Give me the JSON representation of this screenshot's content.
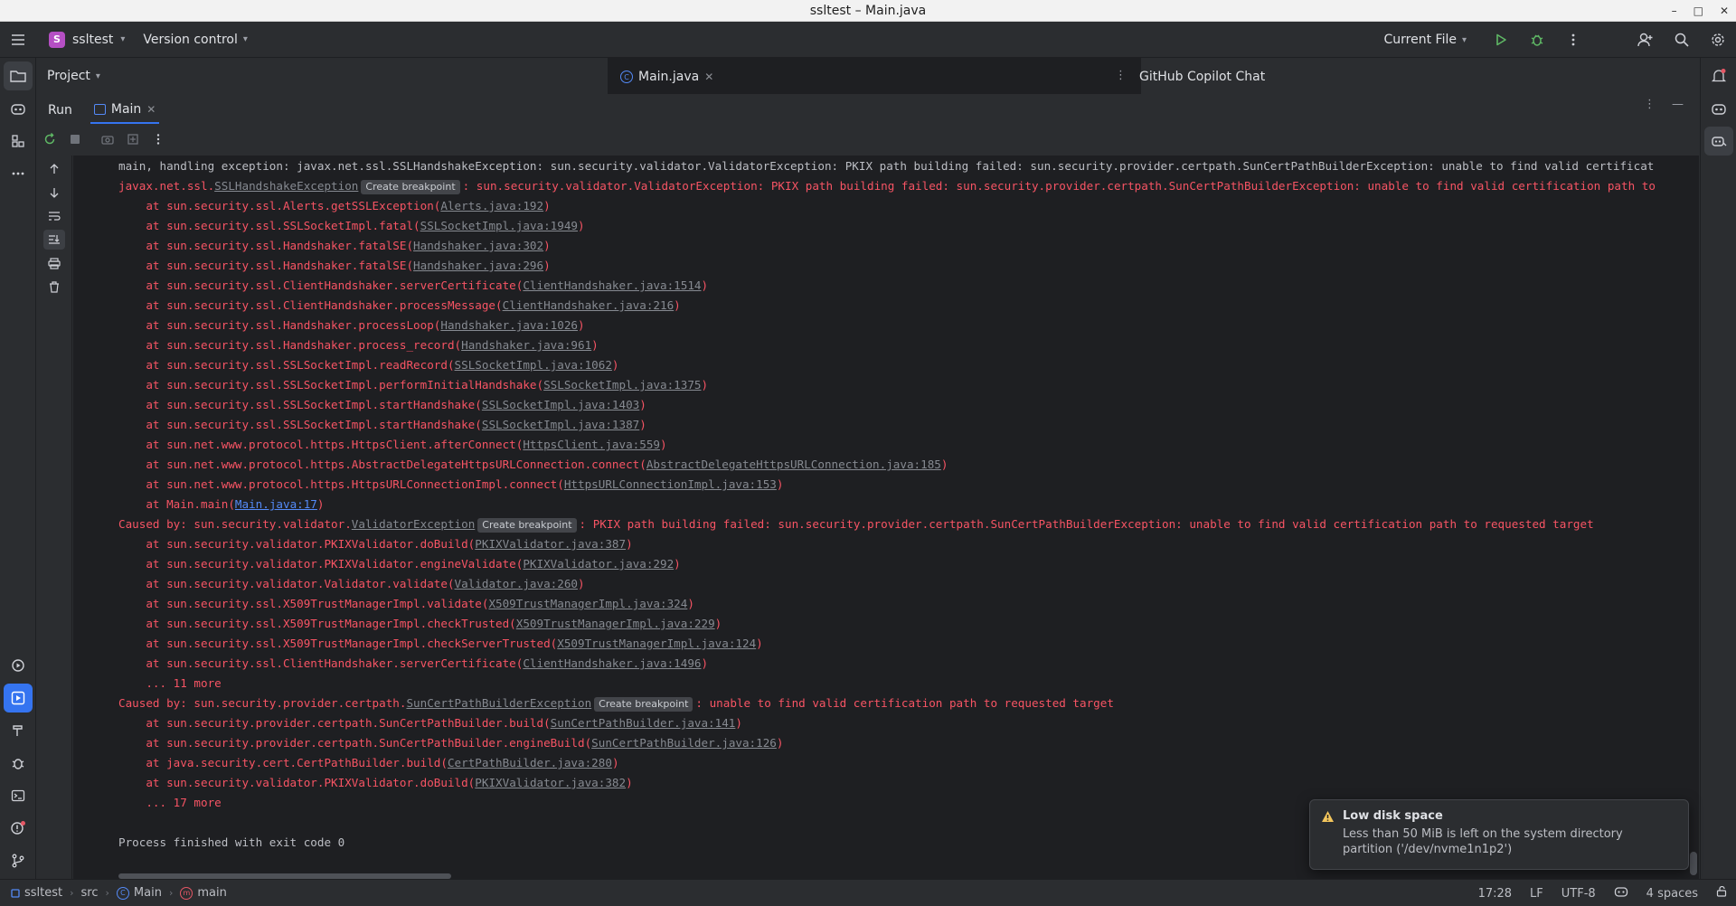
{
  "window": {
    "title": "ssltest – Main.java"
  },
  "toolbar": {
    "project_initial": "S",
    "project_name": "ssltest",
    "vcs_label": "Version control",
    "run_config": "Current File"
  },
  "header": {
    "project_label": "Project",
    "editor_tab": "Main.java",
    "copilot_label": "GitHub Copilot Chat"
  },
  "run_window": {
    "title": "Run",
    "tab_label": "Main"
  },
  "console": {
    "breakpoint_label": "Create breakpoint",
    "lines": {
      "l0": "main, handling exception: javax.net.ssl.SSLHandshakeException: sun.security.validator.ValidatorException: PKIX path building failed: sun.security.provider.certpath.SunCertPathBuilderException: unable to find valid certificat",
      "l1_pre": "javax.net.ssl.",
      "l1_link": "SSLHandshakeException",
      "l1_post": ": sun.security.validator.ValidatorException: PKIX path building failed: sun.security.provider.certpath.SunCertPathBuilderException: unable to find valid certification path to",
      "l2_pre": "    at sun.security.ssl.Alerts.getSSLException(",
      "l2_link": "Alerts.java:192",
      "l3_pre": "    at sun.security.ssl.SSLSocketImpl.fatal(",
      "l3_link": "SSLSocketImpl.java:1949",
      "l4_pre": "    at sun.security.ssl.Handshaker.fatalSE(",
      "l4_link": "Handshaker.java:302",
      "l5_pre": "    at sun.security.ssl.Handshaker.fatalSE(",
      "l5_link": "Handshaker.java:296",
      "l6_pre": "    at sun.security.ssl.ClientHandshaker.serverCertificate(",
      "l6_link": "ClientHandshaker.java:1514",
      "l7_pre": "    at sun.security.ssl.ClientHandshaker.processMessage(",
      "l7_link": "ClientHandshaker.java:216",
      "l8_pre": "    at sun.security.ssl.Handshaker.processLoop(",
      "l8_link": "Handshaker.java:1026",
      "l9_pre": "    at sun.security.ssl.Handshaker.process_record(",
      "l9_link": "Handshaker.java:961",
      "l10_pre": "    at sun.security.ssl.SSLSocketImpl.readRecord(",
      "l10_link": "SSLSocketImpl.java:1062",
      "l11_pre": "    at sun.security.ssl.SSLSocketImpl.performInitialHandshake(",
      "l11_link": "SSLSocketImpl.java:1375",
      "l12_pre": "    at sun.security.ssl.SSLSocketImpl.startHandshake(",
      "l12_link": "SSLSocketImpl.java:1403",
      "l13_pre": "    at sun.security.ssl.SSLSocketImpl.startHandshake(",
      "l13_link": "SSLSocketImpl.java:1387",
      "l14_pre": "    at sun.net.www.protocol.https.HttpsClient.afterConnect(",
      "l14_link": "HttpsClient.java:559",
      "l15_pre": "    at sun.net.www.protocol.https.AbstractDelegateHttpsURLConnection.connect(",
      "l15_link": "AbstractDelegateHttpsURLConnection.java:185",
      "l16_pre": "    at sun.net.www.protocol.https.HttpsURLConnectionImpl.connect(",
      "l16_link": "HttpsURLConnectionImpl.java:153",
      "l17_pre": "    at Main.main(",
      "l17_link": "Main.java:17",
      "l18_pre": "Caused by: sun.security.validator.",
      "l18_link": "ValidatorException",
      "l18_post": ": PKIX path building failed: sun.security.provider.certpath.SunCertPathBuilderException: unable to find valid certification path to requested target",
      "l19_pre": "    at sun.security.validator.PKIXValidator.doBuild(",
      "l19_link": "PKIXValidator.java:387",
      "l20_pre": "    at sun.security.validator.PKIXValidator.engineValidate(",
      "l20_link": "PKIXValidator.java:292",
      "l21_pre": "    at sun.security.validator.Validator.validate(",
      "l21_link": "Validator.java:260",
      "l22_pre": "    at sun.security.ssl.X509TrustManagerImpl.validate(",
      "l22_link": "X509TrustManagerImpl.java:324",
      "l23_pre": "    at sun.security.ssl.X509TrustManagerImpl.checkTrusted(",
      "l23_link": "X509TrustManagerImpl.java:229",
      "l24_pre": "    at sun.security.ssl.X509TrustManagerImpl.checkServerTrusted(",
      "l24_link": "X509TrustManagerImpl.java:124",
      "l25_pre": "    at sun.security.ssl.ClientHandshaker.serverCertificate(",
      "l25_link": "ClientHandshaker.java:1496",
      "l26": "    ... 11 more",
      "l27_pre": "Caused by: sun.security.provider.certpath.",
      "l27_link": "SunCertPathBuilderException",
      "l27_post": ": unable to find valid certification path to requested target",
      "l28_pre": "    at sun.security.provider.certpath.SunCertPathBuilder.build(",
      "l28_link": "SunCertPathBuilder.java:141",
      "l29_pre": "    at sun.security.provider.certpath.SunCertPathBuilder.engineBuild(",
      "l29_link": "SunCertPathBuilder.java:126",
      "l30_pre": "    at java.security.cert.CertPathBuilder.build(",
      "l30_link": "CertPathBuilder.java:280",
      "l31_pre": "    at sun.security.validator.PKIXValidator.doBuild(",
      "l31_link": "PKIXValidator.java:382",
      "l32": "    ... 17 more",
      "l33": "Process finished with exit code 0"
    }
  },
  "notification": {
    "title": "Low disk space",
    "body": "Less than 50 MiB is left on the system directory partition ('/dev/nvme1n1p2')"
  },
  "statusbar": {
    "crumb_project": "ssltest",
    "crumb_src": "src",
    "crumb_class": "Main",
    "crumb_method": "main",
    "position": "17:28",
    "line_sep": "LF",
    "encoding": "UTF-8",
    "indent": "4 spaces"
  },
  "colors": {
    "error_text": "#f75464",
    "accent": "#3574f0",
    "background": "#1e1f22"
  }
}
